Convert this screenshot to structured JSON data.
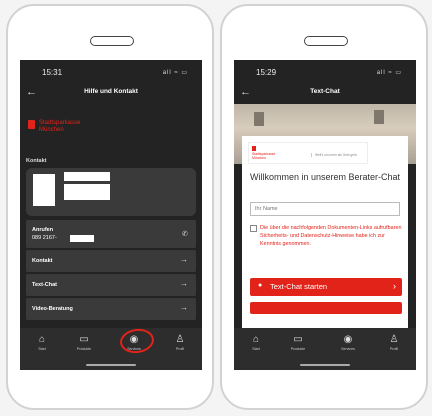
{
  "left": {
    "status": {
      "time": "15:31",
      "icons": "all ≈ ▭"
    },
    "nav": {
      "back": "←",
      "title": "Hilfe und Kontakt"
    },
    "logo": {
      "line1": "Stadtsparkasse",
      "line2": "München"
    },
    "section": "Kontakt",
    "rows": [
      {
        "label": "Anrufen",
        "sub": "089 2167-",
        "icon": "phone-icon"
      },
      {
        "label": "Kontakt",
        "arrow": "→"
      },
      {
        "label": "Text-Chat",
        "arrow": "→"
      },
      {
        "label": "Video-Beratung",
        "arrow": "→"
      }
    ],
    "tabs": [
      {
        "label": "Start",
        "icon": "home-icon"
      },
      {
        "label": "Produkte",
        "icon": "products-icon"
      },
      {
        "label": "Services",
        "icon": "services-icon"
      },
      {
        "label": "Profil",
        "icon": "profile-icon"
      }
    ],
    "highlight_color": "#e2231a"
  },
  "right": {
    "status": {
      "time": "15:29",
      "icons": "all ≈ ▭"
    },
    "nav": {
      "back": "←",
      "title": "Text-Chat"
    },
    "brand": {
      "line1": "Stadtsparkasse",
      "line2": "München",
      "tagline": "Weil's um mehr als Geld geht."
    },
    "welcome": "Willkommen in unserem Berater-Chat",
    "name_placeholder": "Ihr Name",
    "consent": "Die über die nachfolgenden Dokumenten-Links aufrufbaren Sicherheits- und Datenschutz-Hinweise habe ich zur Kenntnis genommen.",
    "start_button": "Text-Chat starten",
    "arrow": "›",
    "tabs": [
      {
        "label": "Start",
        "icon": "home-icon"
      },
      {
        "label": "Produkte",
        "icon": "products-icon"
      },
      {
        "label": "Services",
        "icon": "services-icon"
      },
      {
        "label": "Profil",
        "icon": "profile-icon"
      }
    ],
    "accent_color": "#e2231a"
  }
}
